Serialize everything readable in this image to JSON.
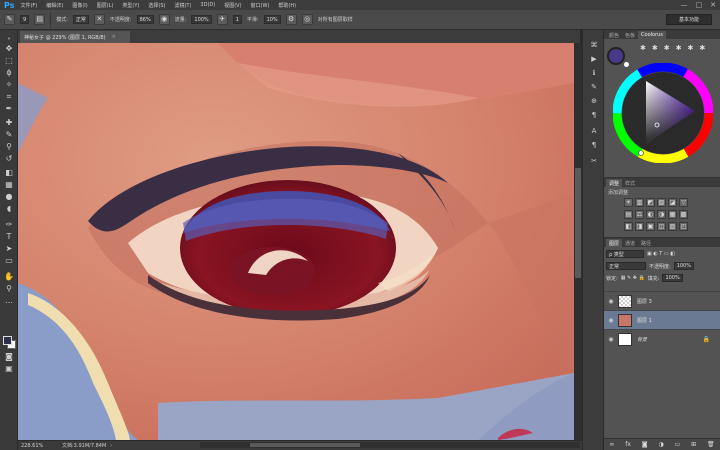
{
  "app": {
    "logo": "Ps",
    "window_controls": [
      "—",
      "□",
      "✕"
    ]
  },
  "menu": {
    "items": [
      "文件(F)",
      "编辑(E)",
      "图像(I)",
      "图层(L)",
      "类型(Y)",
      "选择(S)",
      "滤镜(T)",
      "3D(D)",
      "视图(V)",
      "窗口(W)",
      "帮助(H)"
    ]
  },
  "options": {
    "size_value": "9",
    "mode_label": "模式:",
    "mode_value": "正常",
    "opacity_label": "不透明度:",
    "opacity_value": "86%",
    "flow_label": "流量:",
    "flow_value": "100%",
    "smoothing_label": "平滑:",
    "smoothing_value": "10%",
    "airbrush_label": "1",
    "sample_label": "对所有图层取样",
    "workspace": "基本功能"
  },
  "document": {
    "tab_title": "神秘女子 @ 229% (图层 1, RGB/8)",
    "tab_close": "×"
  },
  "status": {
    "zoom": "228.61%",
    "doc_info": "文档:3.91M/7.84M",
    "arrow": "›"
  },
  "panels": {
    "color_tabs": [
      "颜色",
      "色板",
      "Coolorus"
    ],
    "adjust_tabs": [
      "调整",
      "样式"
    ],
    "adjust_title": "添加调整",
    "adjust_icons": [
      "☀",
      "▥",
      "◩",
      "▧",
      "◪",
      "▽",
      "▤",
      "⚖",
      "◐",
      "◑",
      "▦",
      "▩",
      "◧",
      "◨",
      "▣",
      "◫",
      "▨",
      "◰"
    ],
    "layers_tabs": [
      "图层",
      "通道",
      "路径"
    ],
    "layer_kind": "ρ 类型",
    "blend_mode": "正常",
    "layer_opacity_label": "不透明度:",
    "layer_opacity": "100%",
    "lock_label": "锁定:",
    "fill_label": "填充:",
    "fill_value": "100%",
    "layers": [
      {
        "name": "图层 3",
        "selected": false
      },
      {
        "name": "图层 1",
        "selected": true
      },
      {
        "name": "背景",
        "selected": false
      }
    ],
    "footer_icons": [
      "∞",
      "fx",
      "◙",
      "◑",
      "▭",
      "⊞",
      "🗑"
    ]
  },
  "colors": {
    "foreground": "#4b3a8c",
    "background": "#ffffff",
    "accent_selected_layer": "#6a7a92",
    "skin_base": "#d4826c"
  }
}
